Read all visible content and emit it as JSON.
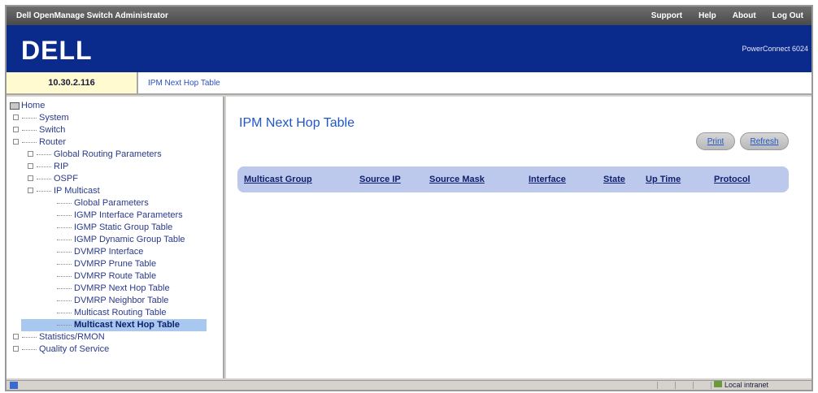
{
  "window": {
    "title": "Dell OpenManage Switch Administrator",
    "links": [
      "Support",
      "Help",
      "About",
      "Log Out"
    ]
  },
  "banner": {
    "logo": "DELL",
    "product": "PowerConnect 6024"
  },
  "device": {
    "ip": "10.30.2.116"
  },
  "breadcrumb": "IPM Next Hop Table",
  "sidebar": {
    "home": "Home",
    "items": [
      {
        "label": "System"
      },
      {
        "label": "Switch"
      },
      {
        "label": "Router"
      },
      {
        "label": "Global Routing Parameters"
      },
      {
        "label": "RIP"
      },
      {
        "label": "OSPF"
      },
      {
        "label": "IP Multicast"
      },
      {
        "label": "Global Parameters"
      },
      {
        "label": "IGMP Interface Parameters"
      },
      {
        "label": "IGMP Static Group Table"
      },
      {
        "label": "IGMP Dynamic Group Table"
      },
      {
        "label": "DVMRP Interface"
      },
      {
        "label": "DVMRP Prune Table"
      },
      {
        "label": "DVMRP Route Table"
      },
      {
        "label": "DVMRP Next Hop Table"
      },
      {
        "label": "DVMRP Neighbor Table"
      },
      {
        "label": "Multicast Routing Table"
      },
      {
        "label": "Multicast Next Hop Table"
      },
      {
        "label": "Statistics/RMON"
      },
      {
        "label": "Quality of Service"
      }
    ]
  },
  "main": {
    "title": "IPM Next Hop Table",
    "print_label": "Print",
    "refresh_label": "Refresh",
    "columns": [
      "Multicast Group",
      "Source IP",
      "Source Mask",
      "Interface",
      "State",
      "Up Time",
      "Protocol"
    ]
  },
  "statusbar": {
    "zone": "Local intranet"
  }
}
